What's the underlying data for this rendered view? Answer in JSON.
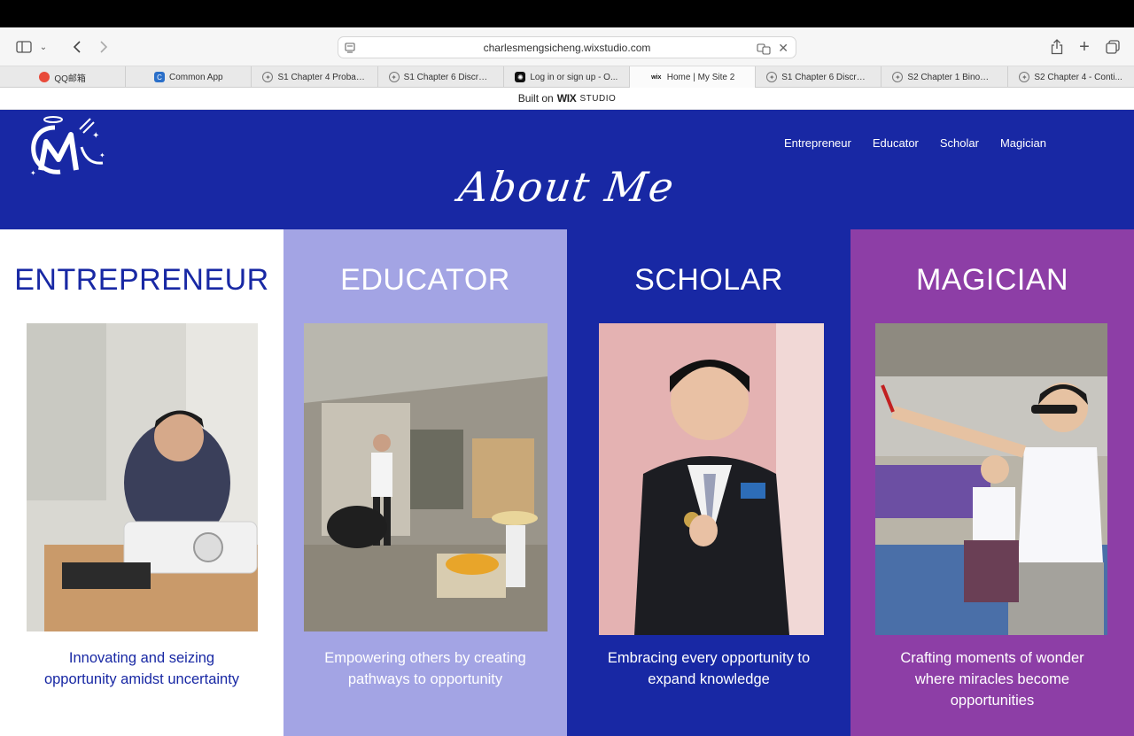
{
  "browser": {
    "url": "charlesmengsicheng.wixstudio.com",
    "tabs": [
      {
        "label": "QQ邮箱",
        "icon": "qq-mail-icon",
        "color": "#e84a3a"
      },
      {
        "label": "Common App",
        "icon": "common-app-icon",
        "color": "#2a6fc9"
      },
      {
        "label": "S1 Chapter 4 Probab...",
        "icon": "compass-icon",
        "color": "#777777"
      },
      {
        "label": "S1 Chapter 6 Discret...",
        "icon": "compass-icon",
        "color": "#777777"
      },
      {
        "label": "Log in or sign up - O...",
        "icon": "openai-icon",
        "color": "#111111"
      },
      {
        "label": "Home | My Site 2",
        "icon": "wix-icon",
        "color": "#111111"
      },
      {
        "label": "S1 Chapter 6 Discret...",
        "icon": "compass-icon",
        "color": "#777777"
      },
      {
        "label": "S2 Chapter 1 Binomi...",
        "icon": "compass-icon",
        "color": "#777777"
      },
      {
        "label": "S2 Chapter 4 - Conti...",
        "icon": "compass-icon",
        "color": "#777777"
      }
    ],
    "active_tab": 5
  },
  "wix_banner": {
    "prefix": "Built on",
    "brand": "WIX",
    "product": "STUDIO"
  },
  "site": {
    "nav": [
      "Entrepreneur",
      "Educator",
      "Scholar",
      "Magician"
    ],
    "page_title": "About Me",
    "colors": {
      "header": "#1828a4",
      "lavender": "#a3a4e4",
      "purple": "#8d3ea6",
      "white": "#ffffff"
    },
    "sections": [
      {
        "title": "ENTREPRENEUR",
        "caption": "Innovating and seizing opportunity amidst uncertainty"
      },
      {
        "title": "EDUCATOR",
        "caption": "Empowering others by creating pathways to opportunity"
      },
      {
        "title": "SCHOLAR",
        "caption": "Embracing every opportunity to expand knowledge"
      },
      {
        "title": "MAGICIAN",
        "caption": "Crafting moments of wonder where miracles become opportunities"
      }
    ]
  }
}
